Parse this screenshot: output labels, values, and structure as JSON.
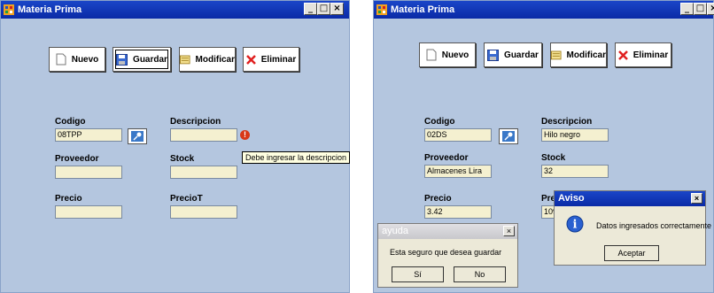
{
  "left_window": {
    "title": "Materia Prima",
    "controls": {
      "minimize": "_",
      "maximize": "□",
      "close": "×"
    },
    "toolbar": {
      "nuevo": "Nuevo",
      "guardar": "Guardar",
      "modificar": "Modificar",
      "eliminar": "Eliminar"
    },
    "form": {
      "codigo_label": "Codigo",
      "codigo_value": "08TPP",
      "descripcion_label": "Descripcion",
      "descripcion_value": "",
      "proveedor_label": "Proveedor",
      "proveedor_value": "",
      "stock_label": "Stock",
      "stock_value": "",
      "precio_label": "Precio",
      "precio_value": "",
      "preciot_label": "PrecioT",
      "preciot_value": ""
    },
    "error_icon": "!",
    "error_tooltip": "Debe ingresar la descripcion"
  },
  "right_window": {
    "title": "Materia Prima",
    "controls": {
      "minimize": "_",
      "maximize": "□",
      "close": "×"
    },
    "toolbar": {
      "nuevo": "Nuevo",
      "guardar": "Guardar",
      "modificar": "Modificar",
      "eliminar": "Eliminar"
    },
    "form": {
      "codigo_label": "Codigo",
      "codigo_value": "02DS",
      "descripcion_label": "Descripcion",
      "descripcion_value": "Hilo negro",
      "proveedor_label": "Proveedor",
      "proveedor_value": "Almacenes Lira",
      "stock_label": "Stock",
      "stock_value": "32",
      "precio_label": "Precio",
      "precio_value": "3.42",
      "preciot_label": "Pre",
      "preciot_value": "109"
    }
  },
  "dialog_ayuda": {
    "title": "ayuda",
    "close": "×",
    "message": "Esta seguro que desea guardar",
    "yes": "Sí",
    "no": "No"
  },
  "dialog_aviso": {
    "title": "Aviso",
    "close": "×",
    "icon": "i",
    "message": "Datos ingresados correctamente",
    "ok": "Aceptar"
  }
}
